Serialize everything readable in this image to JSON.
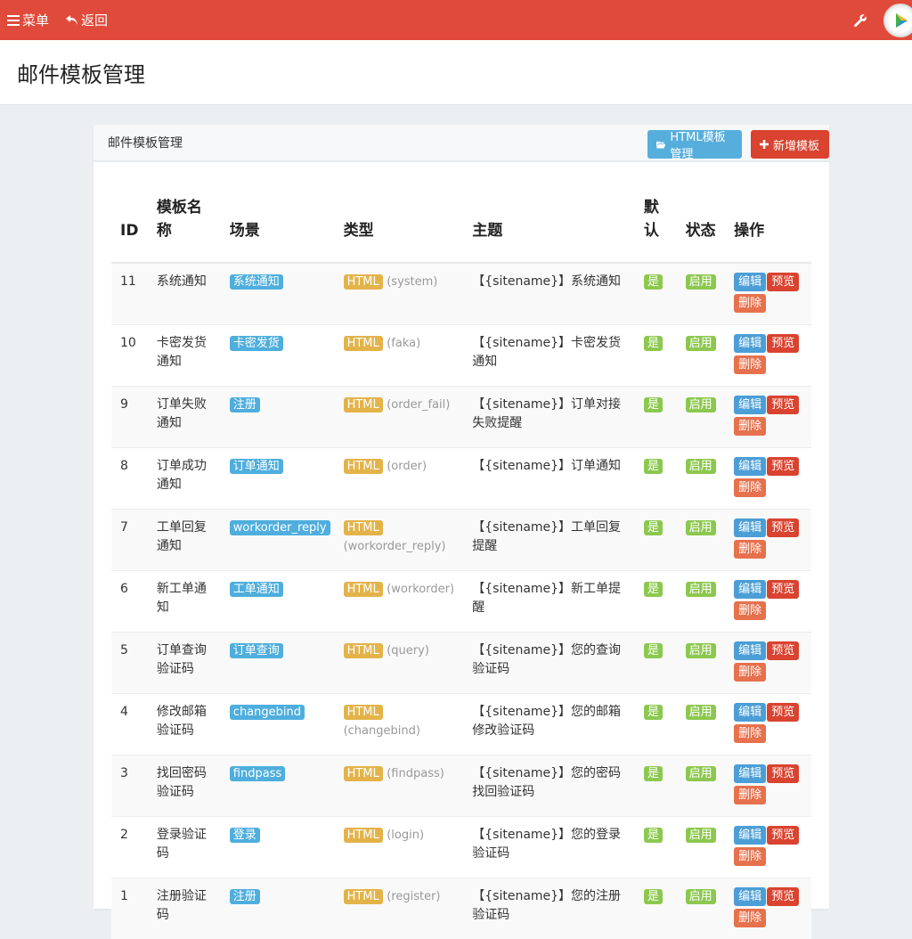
{
  "topbar": {
    "menu_label": "菜单",
    "back_label": "返回"
  },
  "page": {
    "title": "邮件模板管理"
  },
  "panel": {
    "title": "邮件模板管理",
    "html_manage_label": "HTML模板管理",
    "add_label": "新增模板"
  },
  "table": {
    "headers": [
      "ID",
      "模板名称",
      "场景",
      "类型",
      "主题",
      "默认",
      "状态",
      "操作"
    ],
    "rows": [
      {
        "id": "11",
        "name": "系统通知",
        "scene": "系统通知",
        "type": "HTML",
        "type_sub": "(system)",
        "subject": "【{sitename}】系统通知",
        "default": "是",
        "status": "启用"
      },
      {
        "id": "10",
        "name": "卡密发货通知",
        "scene": "卡密发货",
        "type": "HTML",
        "type_sub": "(faka)",
        "subject": "【{sitename}】卡密发货通知",
        "default": "是",
        "status": "启用"
      },
      {
        "id": "9",
        "name": "订单失败通知",
        "scene": "注册",
        "type": "HTML",
        "type_sub": "(order_fail)",
        "subject": "【{sitename}】订单对接失败提醒",
        "default": "是",
        "status": "启用"
      },
      {
        "id": "8",
        "name": "订单成功通知",
        "scene": "订单通知",
        "type": "HTML",
        "type_sub": "(order)",
        "subject": "【{sitename}】订单通知",
        "default": "是",
        "status": "启用"
      },
      {
        "id": "7",
        "name": "工单回复通知",
        "scene": "workorder_reply",
        "type": "HTML",
        "type_sub": "(workorder_reply)",
        "subject": "【{sitename}】工单回复提醒",
        "default": "是",
        "status": "启用"
      },
      {
        "id": "6",
        "name": "新工单通知",
        "scene": "工单通知",
        "type": "HTML",
        "type_sub": "(workorder)",
        "subject": "【{sitename}】新工单提醒",
        "default": "是",
        "status": "启用"
      },
      {
        "id": "5",
        "name": "订单查询验证码",
        "scene": "订单查询",
        "type": "HTML",
        "type_sub": "(query)",
        "subject": "【{sitename}】您的查询验证码",
        "default": "是",
        "status": "启用"
      },
      {
        "id": "4",
        "name": "修改邮箱验证码",
        "scene": "changebind",
        "type": "HTML",
        "type_sub": "(changebind)",
        "subject": "【{sitename}】您的邮箱修改验证码",
        "default": "是",
        "status": "启用"
      },
      {
        "id": "3",
        "name": "找回密码验证码",
        "scene": "findpass",
        "type": "HTML",
        "type_sub": "(findpass)",
        "subject": "【{sitename}】您的密码找回验证码",
        "default": "是",
        "status": "启用"
      },
      {
        "id": "2",
        "name": "登录验证码",
        "scene": "登录",
        "type": "HTML",
        "type_sub": "(login)",
        "subject": "【{sitename}】您的登录验证码",
        "default": "是",
        "status": "启用"
      },
      {
        "id": "1",
        "name": "注册验证码",
        "scene": "注册",
        "type": "HTML",
        "type_sub": "(register)",
        "subject": "【{sitename}】您的注册验证码",
        "default": "是",
        "status": "启用"
      }
    ],
    "actions": {
      "edit": "编辑",
      "preview": "预览",
      "delete": "删除"
    }
  },
  "icons": [
    "menu-icon",
    "back-icon",
    "wrench-icon",
    "folder-open-icon",
    "plus-icon"
  ],
  "colors": {
    "topbar": "#e04a3b",
    "label_blue": "#4eaedd",
    "label_yellow": "#e3b34a",
    "label_green": "#8cc84f"
  }
}
